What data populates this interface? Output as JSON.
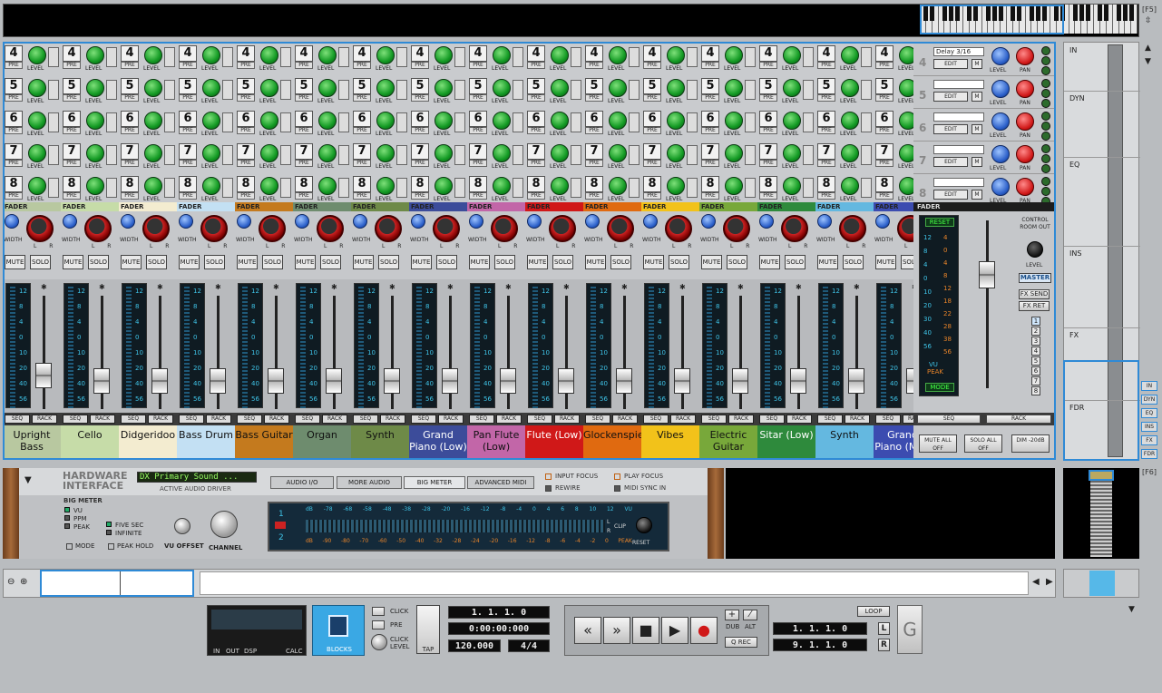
{
  "window": {
    "f5": "[F5]",
    "f6": "[F6]"
  },
  "mixer": {
    "send_numbers": [
      "4",
      "5",
      "6",
      "7",
      "8"
    ],
    "send_pre": "PRE",
    "send_level": "LEVEL",
    "fader_label": "FADER",
    "width_label": "WIDTH",
    "lr_label": "L R",
    "mute": "MUTE",
    "solo": "SOLO",
    "seq": "SEQ",
    "rack": "RACK",
    "meter_scale": [
      "12",
      "8",
      "4",
      "0",
      "10",
      "20",
      "40",
      "56"
    ],
    "channels": [
      {
        "name": "Upright Bass",
        "color": "#b8c8a0"
      },
      {
        "name": "Cello",
        "color": "#c6dca8"
      },
      {
        "name": "Didgeridoo",
        "color": "#f3ecd0"
      },
      {
        "name": "Bass Drum",
        "color": "#c3e0f3"
      },
      {
        "name": "Bass Guitar",
        "color": "#c47a1e"
      },
      {
        "name": "Organ",
        "color": "#6e8c6e"
      },
      {
        "name": "Synth",
        "color": "#6e8a48"
      },
      {
        "name": "Grand Piano (Low)",
        "color": "#3c4c9a"
      },
      {
        "name": "Pan Flute (Low)",
        "color": "#c266a8"
      },
      {
        "name": "Flute (Low)",
        "color": "#d01818"
      },
      {
        "name": "Glockenspiel",
        "color": "#e06a10"
      },
      {
        "name": "Vibes",
        "color": "#f2c21a"
      },
      {
        "name": "Electric Guitar",
        "color": "#78a83a"
      },
      {
        "name": "Sitar (Low)",
        "color": "#2e8a3c"
      },
      {
        "name": "Synth",
        "color": "#64b8e0"
      },
      {
        "name": "Grand Piano (Mid)",
        "color": "#3c4cb0"
      }
    ],
    "master": {
      "fx_rows": [
        {
          "num": "4",
          "display": "Delay 3/16"
        },
        {
          "num": "5",
          "display": ""
        },
        {
          "num": "6",
          "display": ""
        },
        {
          "num": "7",
          "display": ""
        },
        {
          "num": "8",
          "display": ""
        }
      ],
      "edit": "EDIT",
      "m": "M",
      "level": "LEVEL",
      "pan": "PAN",
      "fader": "FADER",
      "reset": "RESET",
      "mode": "MODE",
      "vu": "VU",
      "peak": "PEAK",
      "meter_left": [
        "12",
        "8",
        "4",
        "0",
        "10",
        "20",
        "30",
        "40",
        "56"
      ],
      "meter_right": [
        "4",
        "0",
        "4",
        "8",
        "12",
        "18",
        "22",
        "28",
        "38",
        "56"
      ],
      "control_room": "CONTROL ROOM OUT",
      "cr_level": "LEVEL",
      "master_btn": "MASTER",
      "fx_send": "FX SEND",
      "fx_ret": "FX RET",
      "fx_numbers": [
        "1",
        "2",
        "3",
        "4",
        "5",
        "6",
        "7",
        "8"
      ],
      "seq": "SEQ",
      "rack": "RACK",
      "mute_all_off": "MUTE ALL OFF",
      "solo_all_off": "SOLO ALL OFF",
      "dim": "DIM -20dB"
    }
  },
  "sidebar": {
    "labels": [
      "IN",
      "DYN",
      "EQ",
      "INS",
      "FX",
      "FDR"
    ],
    "tabs": [
      "IN",
      "DYN",
      "EQ",
      "INS",
      "FX",
      "FDR"
    ]
  },
  "hardware": {
    "title_line1": "HARDWARE",
    "title_line2": "INTERFACE",
    "sound_display": "DX Primary Sound ...",
    "driver_label": "ACTIVE AUDIO DRIVER",
    "tabs": [
      "AUDIO I/O",
      "MORE AUDIO",
      "BIG METER",
      "ADVANCED MIDI"
    ],
    "input_focus": "INPUT FOCUS",
    "play_focus": "PLAY FOCUS",
    "rewire": "REWIRE",
    "midi_sync": "MIDI SYNC IN",
    "big_meter_title": "BIG METER",
    "meter_modes": [
      "VU",
      "PPM",
      "PEAK"
    ],
    "hold_modes": [
      "FIVE SEC",
      "INFINITE"
    ],
    "mode": "MODE",
    "peak_hold": "PEAK HOLD",
    "vu_offset": "VU OFFSET",
    "channel": "CHANNEL",
    "bm_scale_top": [
      "dB",
      "-78",
      "-68",
      "-58",
      "-48",
      "-38",
      "-28",
      "-20",
      "-16",
      "-12",
      "-8",
      "-4",
      "0",
      "4",
      "6",
      "8",
      "10",
      "12",
      "VU"
    ],
    "bm_scale_bottom": [
      "dB",
      "-90",
      "-80",
      "-70",
      "-60",
      "-50",
      "-40",
      "-32",
      "-28",
      "-24",
      "-20",
      "-16",
      "-12",
      "-8",
      "-6",
      "-4",
      "-2",
      "0",
      "PEAK"
    ],
    "bm_ch1": "1",
    "bm_ch2": "2",
    "bm_l": "L",
    "bm_r": "R",
    "clip": "CLIP",
    "reset": "RESET"
  },
  "transport": {
    "dsp_in": "IN",
    "dsp_out": "OUT",
    "dsp": "DSP",
    "calc": "CALC",
    "blocks": "BLOCKS",
    "click": "CLICK",
    "pre": "PRE",
    "click_level": "CLICK LEVEL",
    "tap": "TAP",
    "position": "1. 1. 1.   0",
    "time": "0:00:00:000",
    "tempo": "120.000",
    "signature": "4/4",
    "dub": "DUB",
    "alt": "ALT",
    "q_rec": "Q REC",
    "loop": "LOOP",
    "loop_left": "1. 1. 1.   0",
    "loop_right": "9. 1. 1.   0",
    "l": "L",
    "r": "R"
  },
  "colors": {
    "accent": "#2f8ad6"
  }
}
